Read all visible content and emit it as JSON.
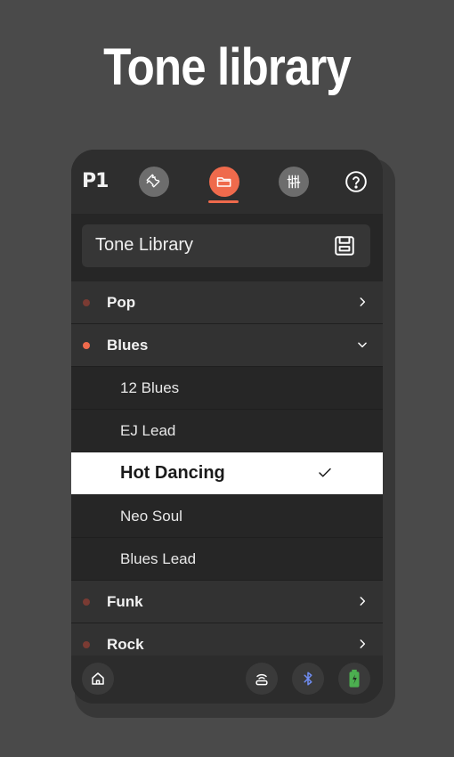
{
  "headline": "Tone library",
  "app": {
    "logo": "P1",
    "nav": [
      {
        "name": "tools",
        "icon": "wrench-icon"
      },
      {
        "name": "library",
        "icon": "folder-icon",
        "active": true
      },
      {
        "name": "eq",
        "icon": "sliders-icon"
      },
      {
        "name": "help",
        "icon": "help-icon"
      }
    ],
    "library_title": "Tone Library",
    "save_icon": "save-icon"
  },
  "list": {
    "categories": [
      {
        "label": "Pop",
        "expanded": false
      },
      {
        "label": "Blues",
        "expanded": true,
        "tones": [
          "12 Blues",
          "EJ Lead",
          "Hot Dancing",
          "Neo Soul",
          "Blues Lead"
        ],
        "selected": "Hot Dancing"
      },
      {
        "label": "Funk",
        "expanded": false
      },
      {
        "label": "Rock",
        "expanded": false
      }
    ]
  },
  "bottombar": {
    "icons": [
      "home-icon",
      "pedal-icon",
      "bluetooth-icon",
      "battery-icon"
    ]
  },
  "colors": {
    "accent": "#ef6a4c",
    "background": "#4a4a4a",
    "panel": "#2c2c2c"
  }
}
